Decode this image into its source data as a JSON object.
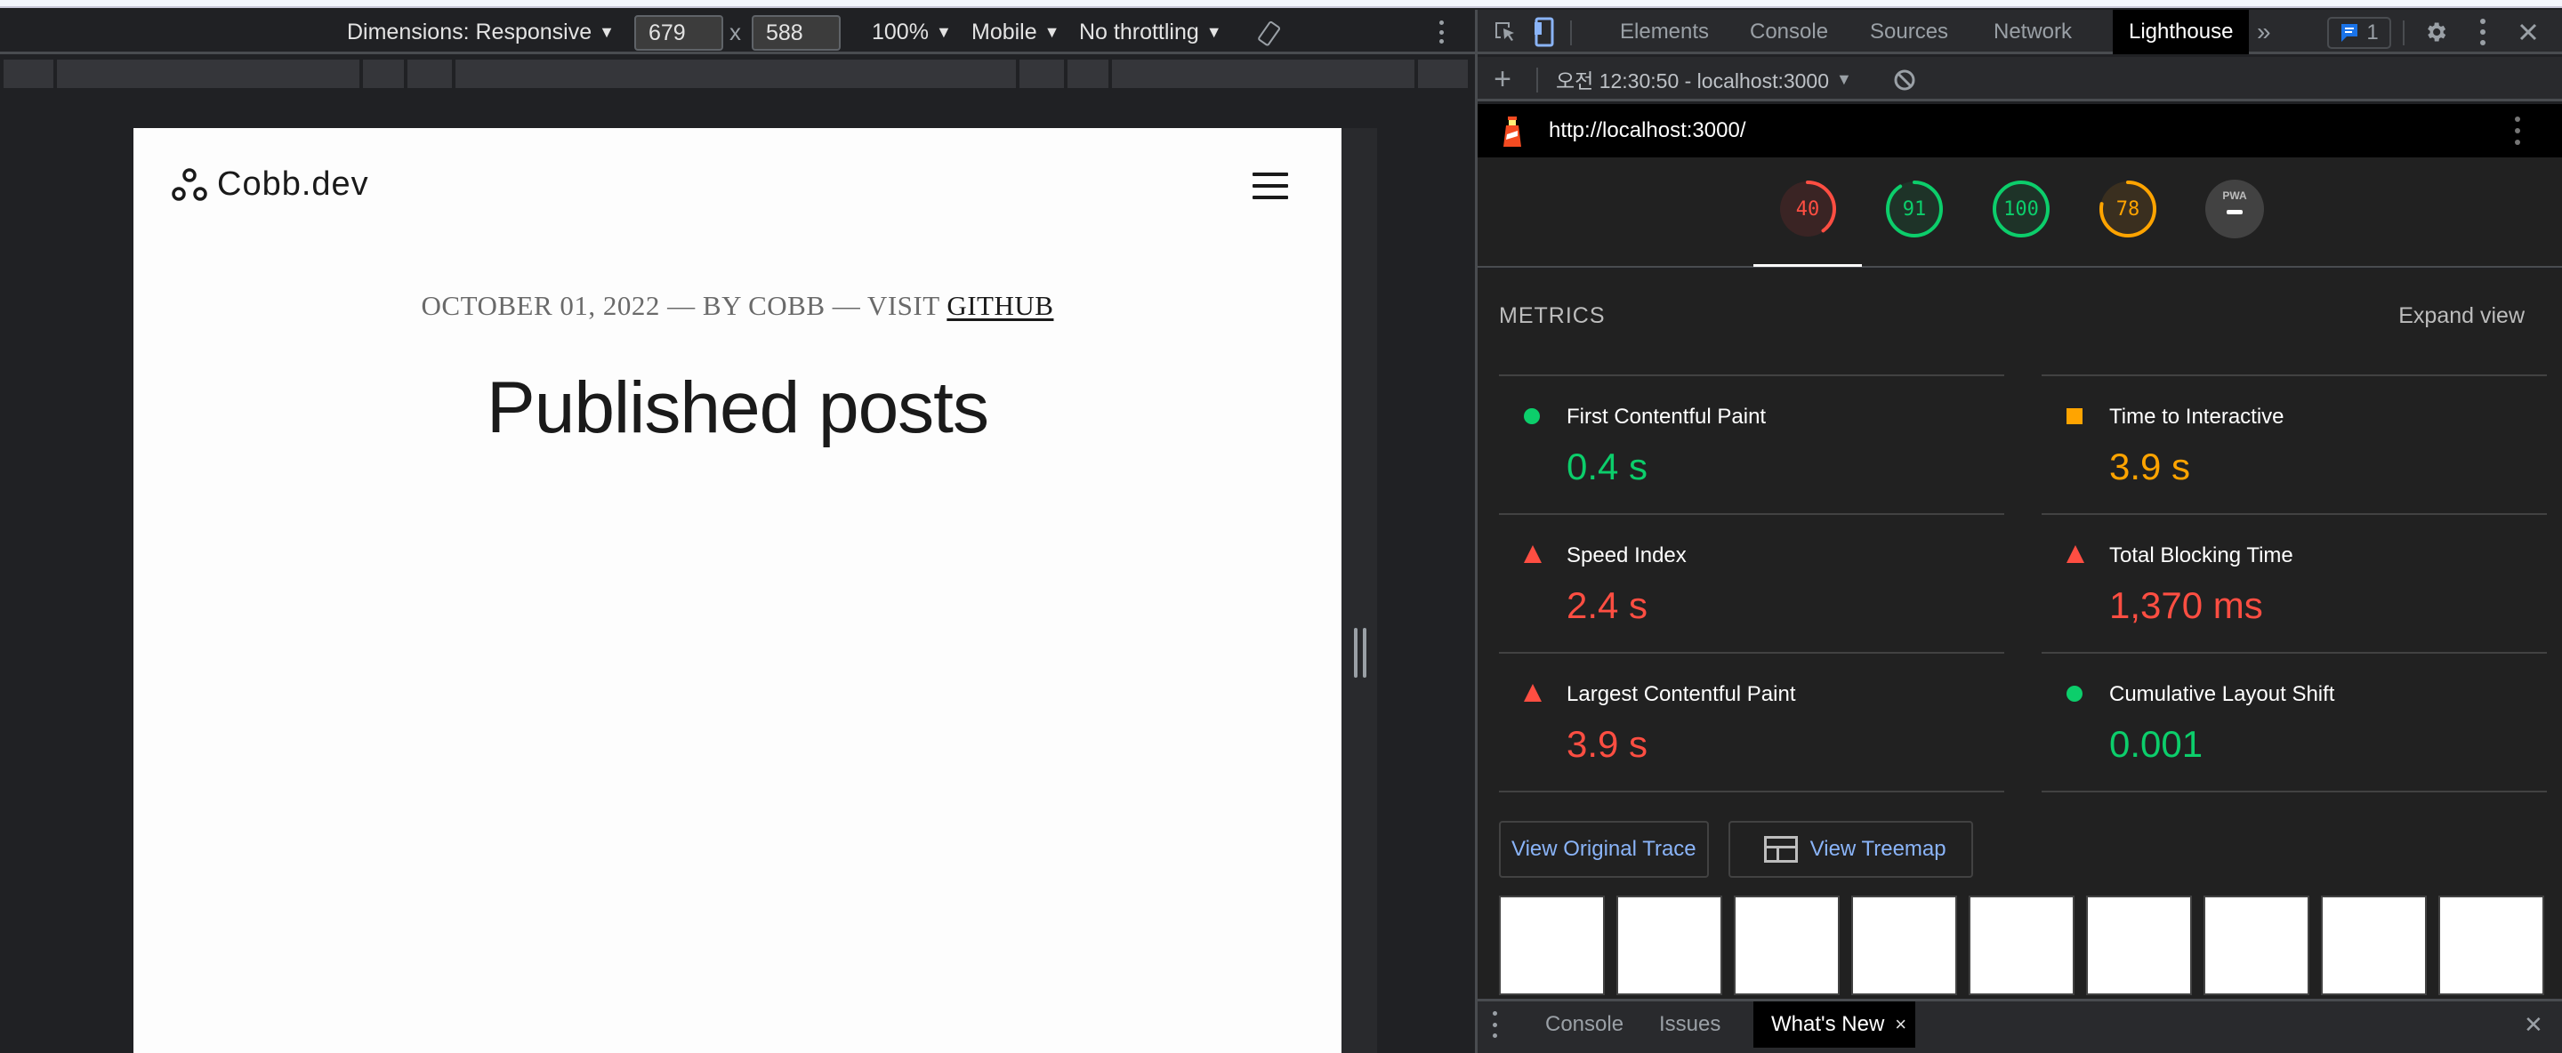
{
  "device_toolbar": {
    "dimensions_label": "Dimensions: Responsive",
    "width_value": "679",
    "height_value": "588",
    "times_sign": "x",
    "zoom_label": "100%",
    "device_type_label": "Mobile",
    "throttling_label": "No throttling",
    "caret": "▼",
    "rotate_icon": "rotate-icon",
    "more_icon": "more-options-icon"
  },
  "page": {
    "logo_text": "Cobb.dev",
    "meta_prefix": "OCTOBER 01, 2022 — BY COBB — VISIT ",
    "meta_link": "GITHUB",
    "heading": "Published posts"
  },
  "devtools": {
    "tabs": [
      {
        "label": "Elements"
      },
      {
        "label": "Console"
      },
      {
        "label": "Sources"
      },
      {
        "label": "Network"
      },
      {
        "label": "Lighthouse",
        "active": true
      }
    ],
    "more_tabs": "»",
    "issues_count": "1",
    "colors": {
      "accent_blue": "#1a73e8",
      "link_blue": "#8ab4f8",
      "pass_green": "#0cce6b",
      "average_orange": "#ffa400",
      "fail_red": "#ff4e42"
    },
    "lighthouse_toolbar": {
      "add_label": "+",
      "report_selector": "오전 12:30:50 - localhost:3000",
      "caret": "▼"
    },
    "report_url": "http://localhost:3000/",
    "scores": [
      {
        "category": "performance",
        "value": 40,
        "label": "40",
        "rating": "fail"
      },
      {
        "category": "accessibility",
        "value": 91,
        "label": "91",
        "rating": "pass"
      },
      {
        "category": "best-practices",
        "value": 100,
        "label": "100",
        "rating": "pass"
      },
      {
        "category": "seo",
        "value": 78,
        "label": "78",
        "rating": "average"
      },
      {
        "category": "pwa",
        "label": "PWA",
        "rating": "na"
      }
    ],
    "metrics": {
      "title": "METRICS",
      "expand_label": "Expand view",
      "items": [
        {
          "name": "First Contentful Paint",
          "value": "0.4 s",
          "rating": "pass"
        },
        {
          "name": "Time to Interactive",
          "value": "3.9 s",
          "rating": "average"
        },
        {
          "name": "Speed Index",
          "value": "2.4 s",
          "rating": "fail"
        },
        {
          "name": "Total Blocking Time",
          "value": "1,370 ms",
          "rating": "fail"
        },
        {
          "name": "Largest Contentful Paint",
          "value": "3.9 s",
          "rating": "fail"
        },
        {
          "name": "Cumulative Layout Shift",
          "value": "0.001",
          "rating": "pass"
        }
      ]
    },
    "buttons": {
      "view_trace": "View Original Trace",
      "view_treemap": "View Treemap"
    },
    "filmstrip_frame_count": 9,
    "drawer": {
      "tabs": [
        {
          "label": "Console"
        },
        {
          "label": "Issues"
        },
        {
          "label": "What's New",
          "active": true,
          "closable": true
        }
      ],
      "close_tab_glyph": "×",
      "close_drawer_glyph": "✕"
    }
  }
}
